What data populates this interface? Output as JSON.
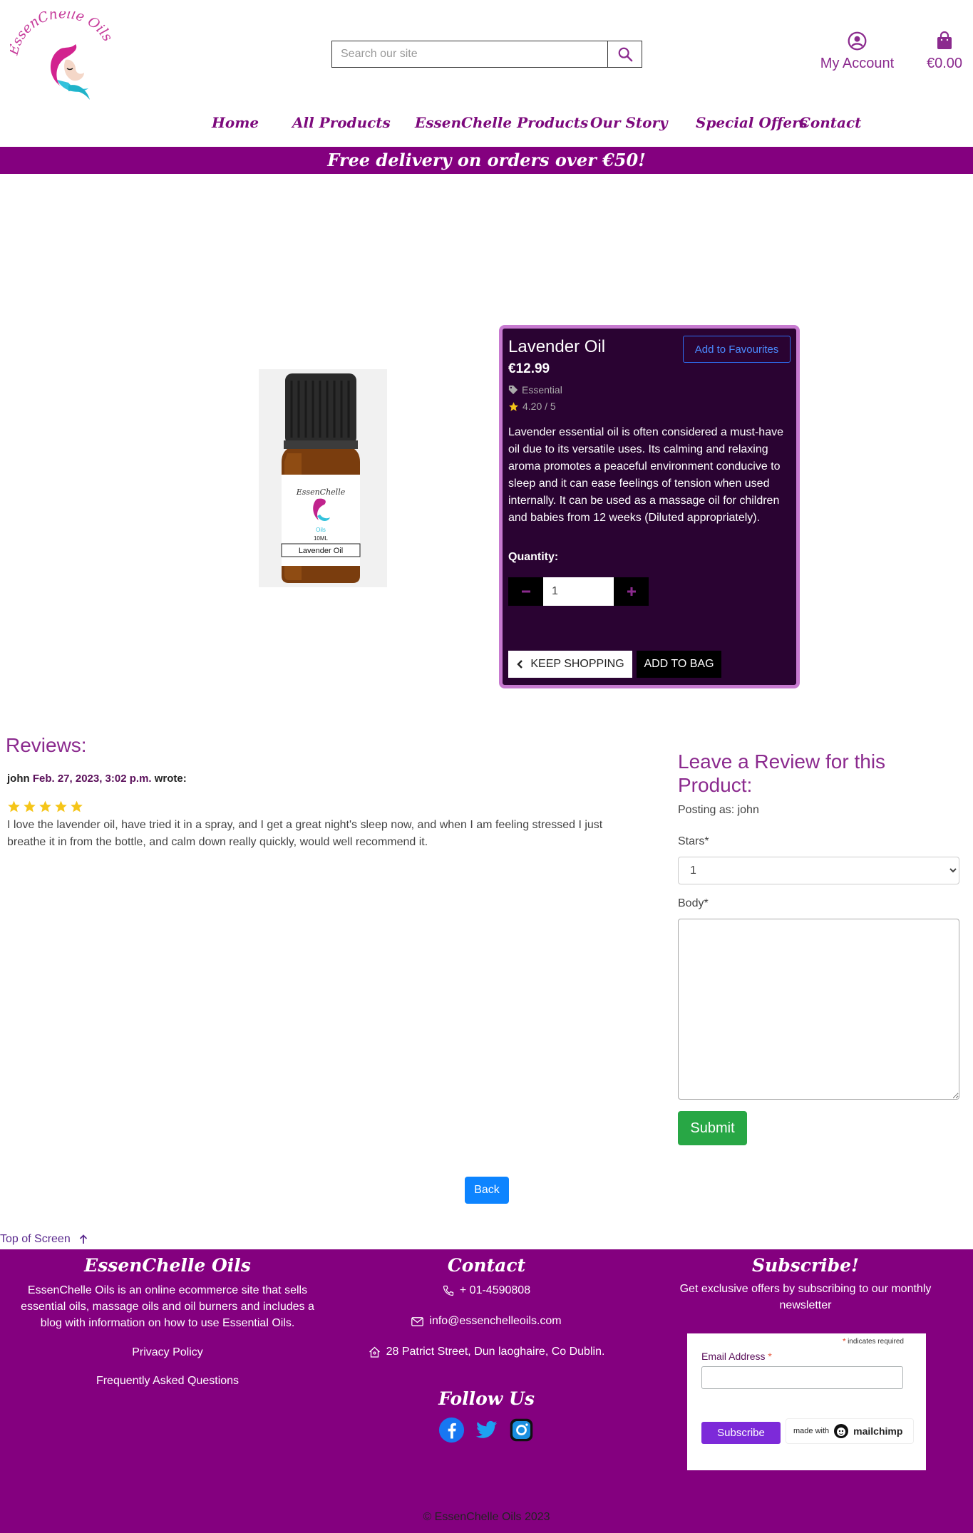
{
  "brand": {
    "name": "EssenChelle Oils",
    "colors": {
      "primary": "#84007f",
      "accent": "#8b2a8e",
      "card_bg": "#2a0332",
      "card_border": "#c77ad0",
      "success": "#28a745",
      "link_blue": "#0d84ff"
    }
  },
  "header": {
    "search_placeholder": "Search our site",
    "account_label": "My Account",
    "bag_total": "€0.00"
  },
  "nav": {
    "items": [
      "Home",
      "All Products",
      "EssenChelle Products",
      "Our Story",
      "Special Offers",
      "Contact"
    ]
  },
  "banner": {
    "text": "Free delivery on orders over €50!"
  },
  "product": {
    "bottle_brand": "EssenChelle",
    "bottle_sub": "Oils",
    "bottle_size": "10ML",
    "bottle_label": "Lavender Oil",
    "name": "Lavender Oil",
    "price": "€12.99",
    "favourite_label": "Add to Favourites",
    "category": "Essential",
    "rating": "4.20 / 5",
    "description": "Lavender essential oil is often considered a must-have oil due to its versatile uses. Its calming and relaxing aroma promotes a peaceful environment conducive to sleep and it can ease feelings of tension when used internally. It can be used as a massage oil for children and babies from 12 weeks (Diluted appropriately).",
    "quantity_label": "Quantity:",
    "quantity_value": "1",
    "keep_shopping_label": "KEEP SHOPPING",
    "add_to_bag_label": "ADD TO BAG"
  },
  "reviews": {
    "heading": "Reviews:",
    "items": [
      {
        "author": "john",
        "date": "Feb. 27, 2023, 3:02 p.m.",
        "wrote": "wrote:",
        "stars": 5,
        "body": "I love the lavender oil, have tried it in a spray, and I get a great night's sleep now, and when I am feeling stressed I just breathe it in from the bottle, and calm down really quickly, would well recommend it."
      }
    ]
  },
  "review_form": {
    "heading": "Leave a Review for this Product:",
    "posting_as": "Posting as: john",
    "stars_label": "Stars*",
    "stars_selected": "1",
    "body_label": "Body*",
    "submit_label": "Submit"
  },
  "back_label": "Back",
  "top_link": "Top of Screen",
  "footer": {
    "about_heading": "EssenChelle Oils",
    "about_text": "EssenChelle Oils is an online ecommerce site that sells essential oils, massage oils and oil burners and includes a blog with information on how to use Essential Oils.",
    "privacy_link": "Privacy Policy",
    "faq_link": "Frequently Asked Questions",
    "contact_heading": "Contact",
    "phone": "+ 01-4590808",
    "email": "info@essenchelleoils.com",
    "address": "28 Patrict Street, Dun laoghaire, Co Dublin.",
    "follow_heading": "Follow Us",
    "social_icons": [
      "facebook-icon",
      "twitter-icon",
      "instagram-icon"
    ],
    "subscribe_heading": "Subscribe!",
    "subscribe_text": "Get exclusive offers by subscribing to our monthly newsletter",
    "mc_required_star": "*",
    "mc_required_text": "indicates required",
    "mc_email_label": "Email Address",
    "mc_email_star": "*",
    "mc_subscribe_label": "Subscribe",
    "mc_made_with": "made with",
    "mc_brand": "mailchimp",
    "copyright": "© EssenChelle Oils 2023"
  }
}
